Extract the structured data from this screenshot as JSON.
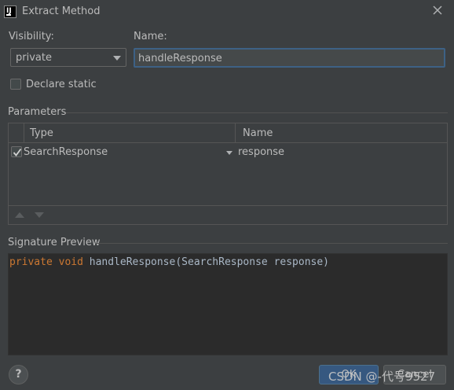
{
  "window": {
    "title": "Extract Method"
  },
  "visibility": {
    "label": "Visibility:",
    "value": "private"
  },
  "name": {
    "label": "Name:",
    "value": "handleResponse"
  },
  "declare_static": {
    "label": "Declare static",
    "checked": false
  },
  "parameters": {
    "section_label": "Parameters",
    "columns": [
      "Type",
      "Name"
    ],
    "rows": [
      {
        "checked": true,
        "type": "SearchResponse",
        "name": "response"
      }
    ]
  },
  "signature_preview": {
    "section_label": "Signature Preview",
    "tokens": {
      "kw1": "private",
      "kw2": "void",
      "rest": "handleResponse(SearchResponse response)"
    }
  },
  "buttons": {
    "help": "?",
    "ok": "OK",
    "cancel": "Cancel"
  },
  "watermark": "CSDN @-代号9527",
  "colors": {
    "background": "#3c3f41",
    "editor_bg": "#2b2b2b",
    "keyword": "#cc7832",
    "accent": "#365880",
    "focus_border": "#3d6185"
  }
}
